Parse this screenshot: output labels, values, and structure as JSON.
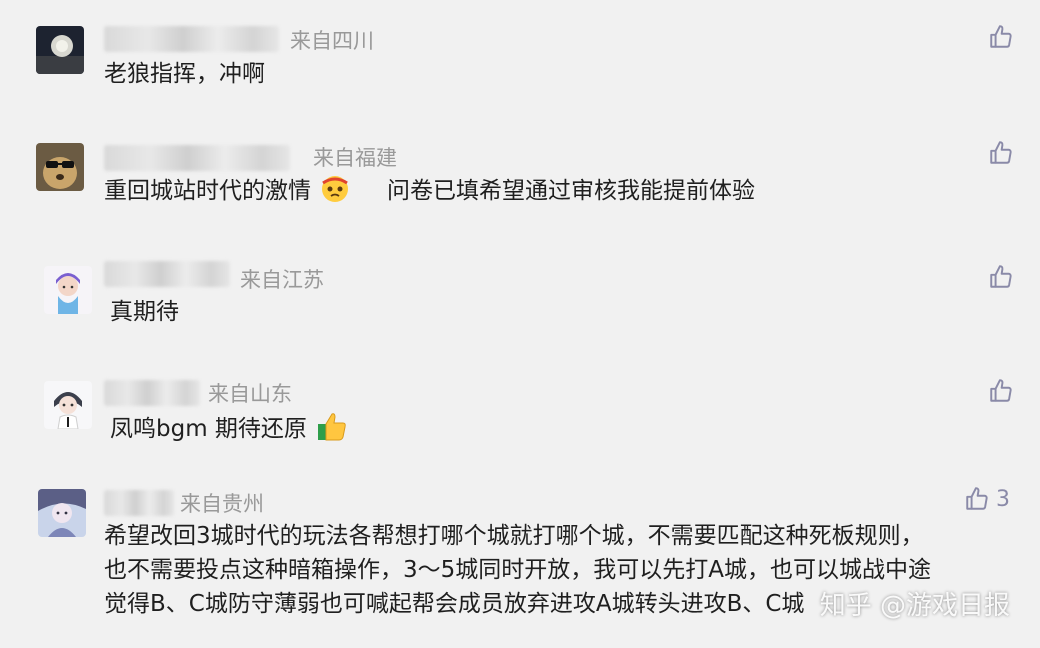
{
  "comments": [
    {
      "location": "来自四川",
      "lines": [
        "老狼指挥，冲啊"
      ],
      "like_count": ""
    },
    {
      "location": "来自福建",
      "lines": [
        "重回城站时代的激情",
        "问卷已填希望通过审核我能提前体验"
      ],
      "like_count": ""
    },
    {
      "location": "来自江苏",
      "lines": [
        "真期待"
      ],
      "like_count": ""
    },
    {
      "location": "来自山东",
      "lines": [
        "凤鸣bgm  期待还原"
      ],
      "like_count": ""
    },
    {
      "location": "来自贵州",
      "lines": [
        "希望改回3城时代的玩法各帮想打哪个城就打哪个城，不需要匹配这种死板规则，",
        "也不需要投点这种暗箱操作，3～5城同时开放，我可以先打A城，也可以城战中途",
        "觉得B、C城防守薄弱也可喊起帮会成员放弃进攻A城转头进攻B、C城"
      ],
      "like_count": "3"
    }
  ],
  "watermark": "知乎 @游戏日报",
  "icons": {
    "like": "thumbs-up-icon",
    "emoji_1": "pleading-face-icon",
    "emoji_2": "thumbs-up-emoji-icon"
  },
  "colors": {
    "background": "#f1f1f1",
    "text": "#1f1f1f",
    "muted": "#999999",
    "like_icon": "#8a8aa8"
  }
}
